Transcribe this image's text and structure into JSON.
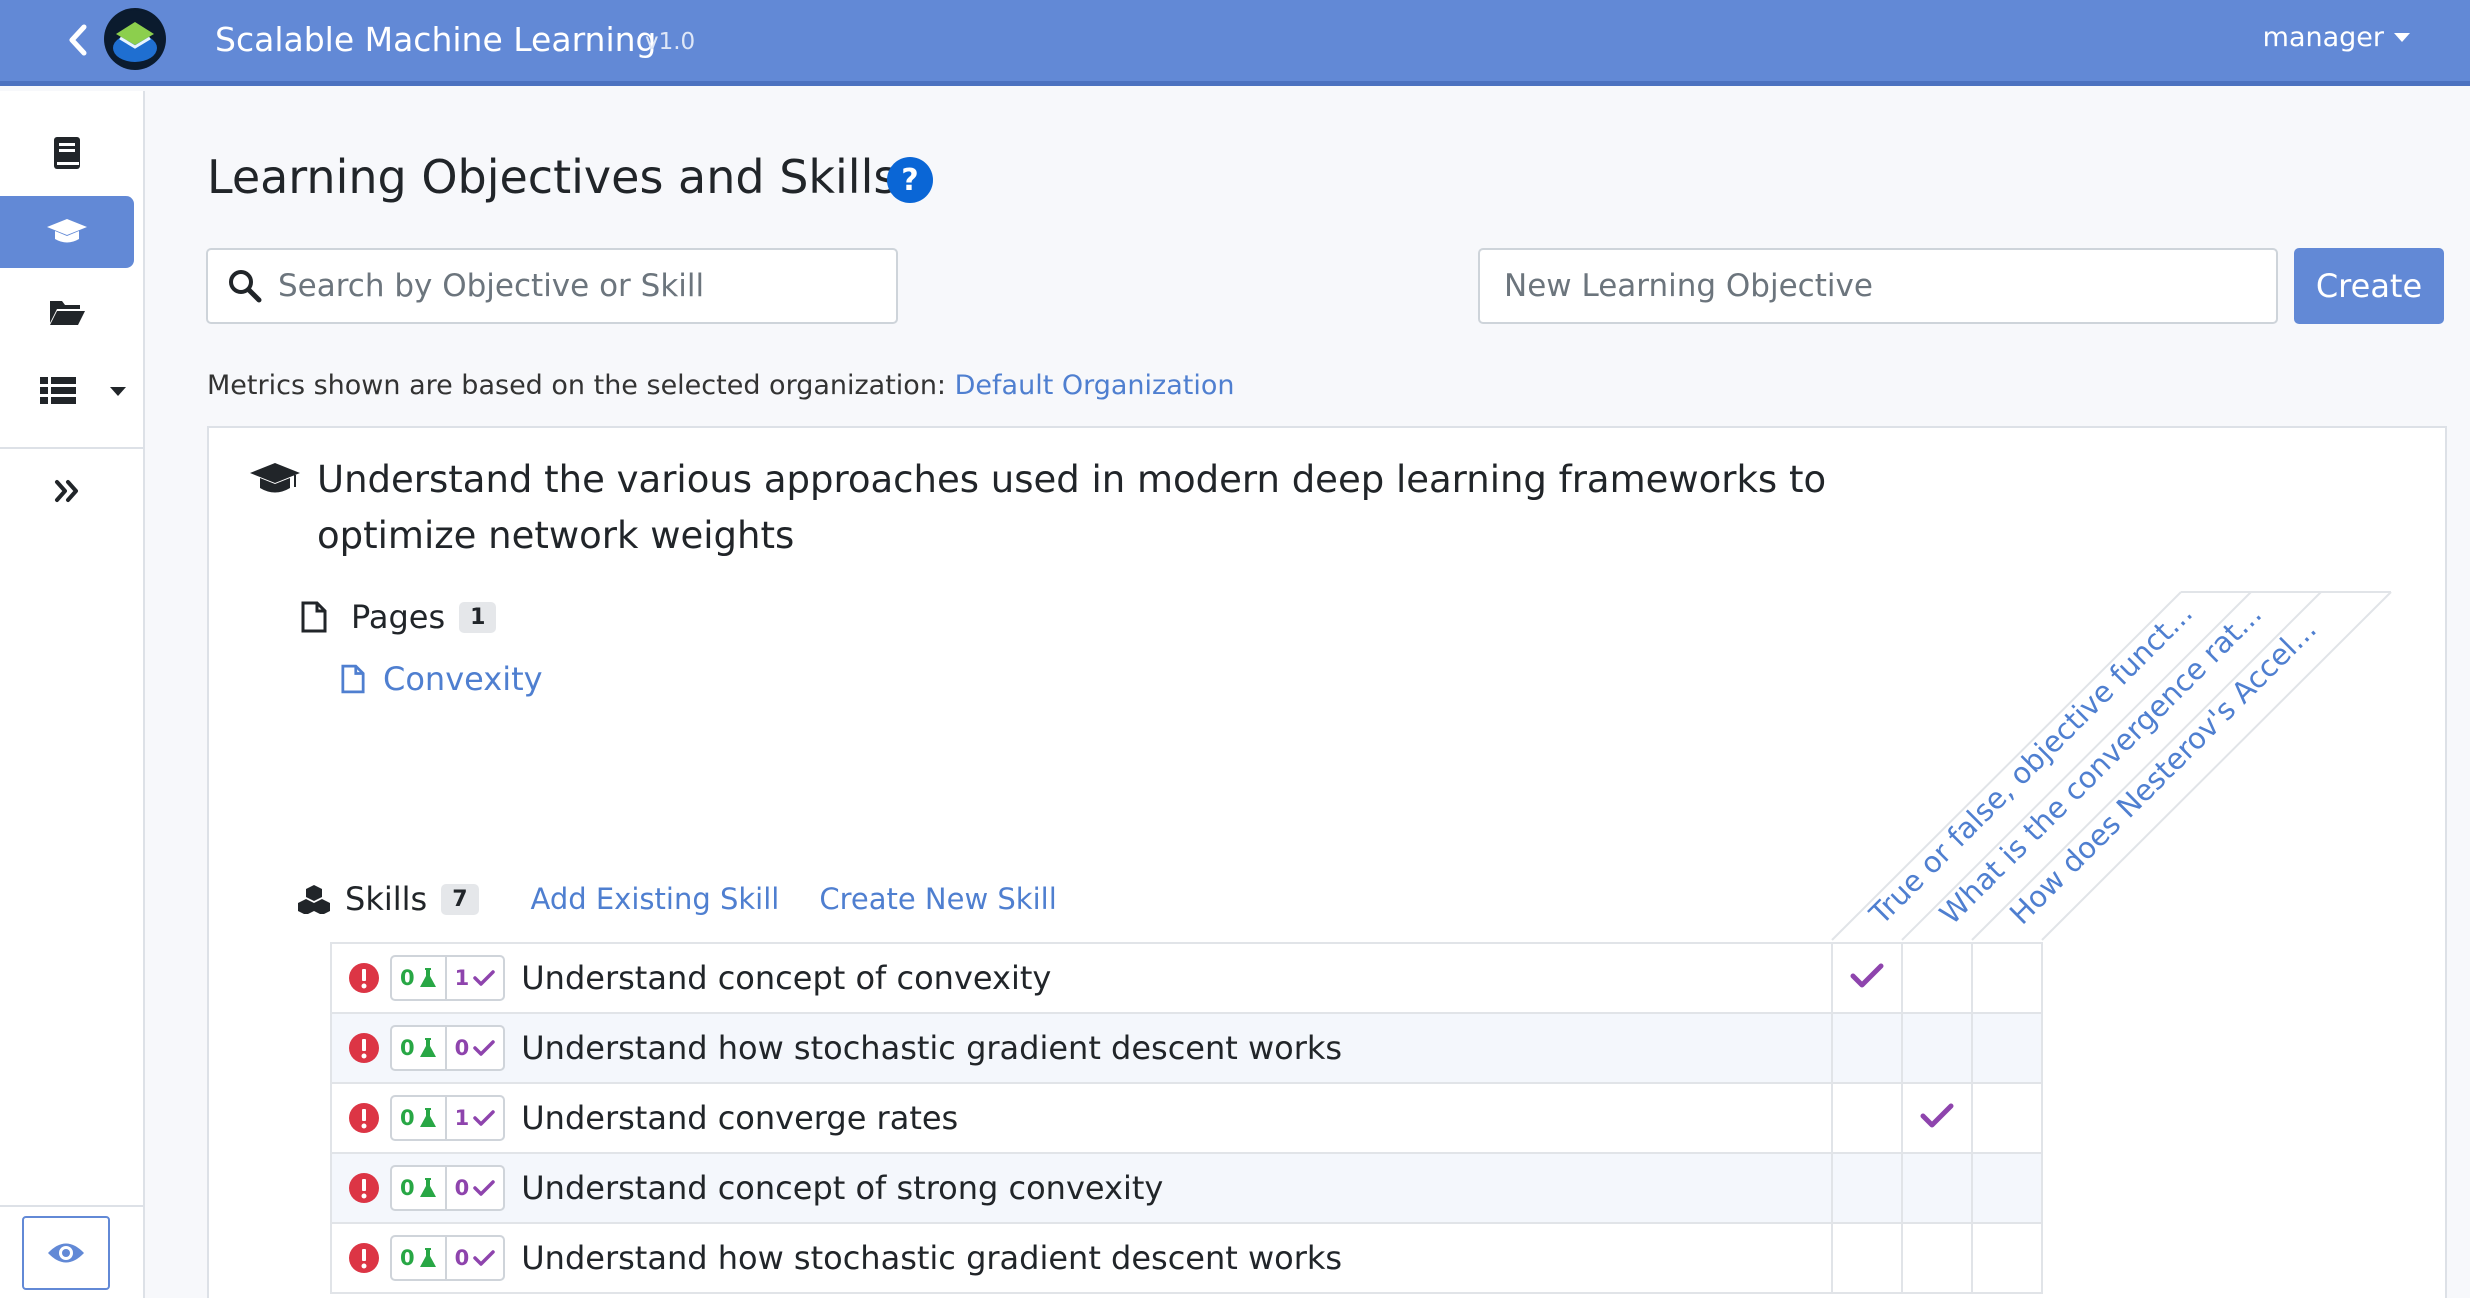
{
  "header": {
    "app_title": "Scalable Machine Learning",
    "version": "v1.0",
    "user": "manager"
  },
  "sidebar": {
    "items": [
      {
        "icon": "book-icon",
        "active": false
      },
      {
        "icon": "graduation-cap-icon",
        "active": true
      },
      {
        "icon": "folder-open-icon",
        "active": false
      },
      {
        "icon": "list-icon",
        "active": false
      },
      {
        "icon": "expand-icon",
        "active": false
      }
    ],
    "bottom_icon": "eye-icon"
  },
  "page": {
    "title": "Learning Objectives and Skills",
    "search_placeholder": "Search by Objective or Skill",
    "new_objective_placeholder": "New Learning Objective",
    "create_label": "Create",
    "metrics_text": "Metrics shown are based on the selected organization: ",
    "organization": "Default Organization"
  },
  "objective": {
    "title": "Understand the various approaches used in modern deep learning frameworks to optimize network weights",
    "pages_label": "Pages",
    "pages_count": "1",
    "pages": [
      "Convexity"
    ],
    "skills_label": "Skills",
    "skills_count": "7",
    "add_existing_label": "Add Existing Skill",
    "create_new_label": "Create New Skill",
    "question_headers": [
      "True or false, objective funct...",
      "What is the convergence rat...",
      "How does Nesterov's Accel..."
    ],
    "skills": [
      {
        "name": "Understand concept of convexity",
        "a": "0",
        "b": "1",
        "checks": [
          true,
          false,
          false
        ]
      },
      {
        "name": "Understand how stochastic gradient descent works",
        "a": "0",
        "b": "0",
        "checks": [
          false,
          false,
          false
        ]
      },
      {
        "name": "Understand converge rates",
        "a": "0",
        "b": "1",
        "checks": [
          false,
          true,
          false
        ]
      },
      {
        "name": "Understand concept of strong convexity",
        "a": "0",
        "b": "0",
        "checks": [
          false,
          false,
          false
        ]
      },
      {
        "name": "Understand how stochastic gradient descent works",
        "a": "0",
        "b": "0",
        "checks": [
          false,
          false,
          false
        ]
      }
    ]
  },
  "colors": {
    "brand": "#6289d6",
    "link": "#4f7fd0",
    "success": "#28a745",
    "purple": "#8e44ad",
    "danger": "#dc3545"
  }
}
